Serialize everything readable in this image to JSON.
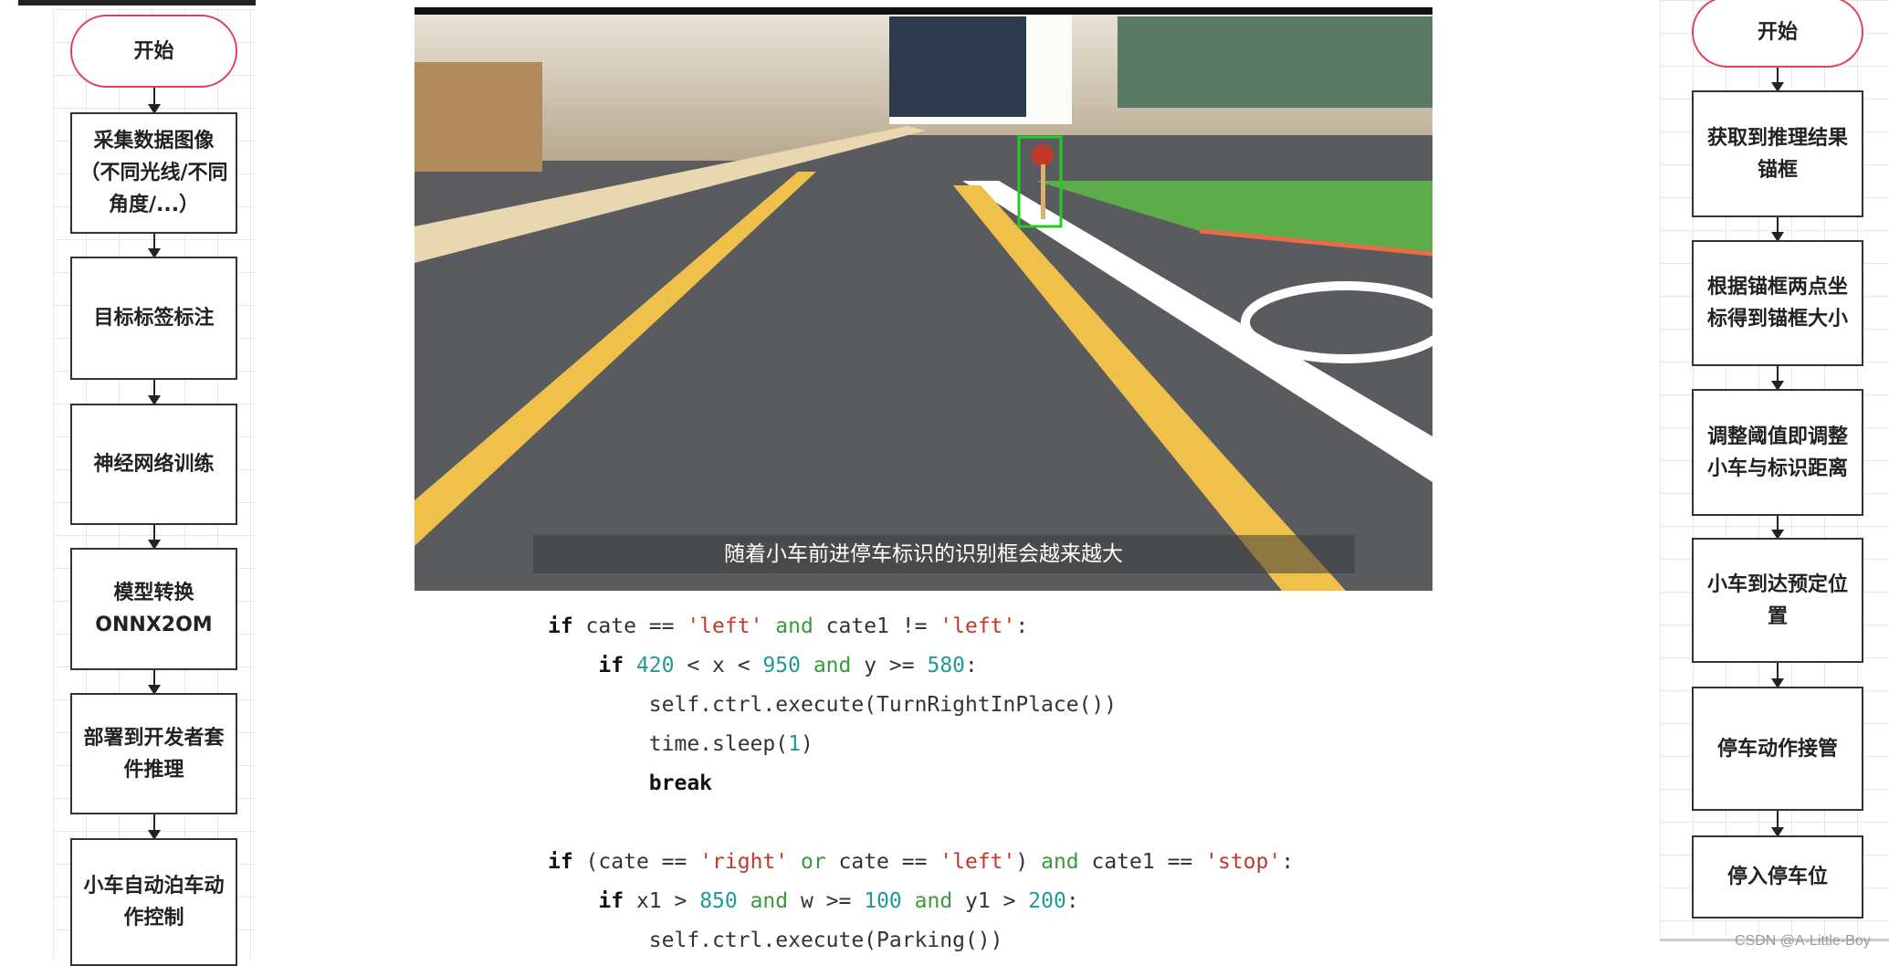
{
  "left_flow": {
    "start": "开始",
    "steps": [
      "采集数据图像（不同光线/不同角度/...）",
      "目标标签标注",
      "神经网络训练",
      "模型转换ONNX2OM",
      "部署到开发者套件推理",
      "小车自动泊车动作控制"
    ]
  },
  "video": {
    "subtitle": "随着小车前进停车标识的识别框会越来越大",
    "detection_box_color": "#22cc22"
  },
  "code": {
    "lines": [
      [
        {
          "t": "if",
          "c": "kw"
        },
        {
          "t": " cate == "
        },
        {
          "t": "'left'",
          "c": "st"
        },
        {
          "t": " and ",
          "c": "op"
        },
        {
          "t": "cate1 != "
        },
        {
          "t": "'left'",
          "c": "st"
        },
        {
          "t": ":"
        }
      ],
      [
        {
          "t": "    "
        },
        {
          "t": "if",
          "c": "kw"
        },
        {
          "t": " "
        },
        {
          "t": "420",
          "c": "nm"
        },
        {
          "t": " < x < "
        },
        {
          "t": "950",
          "c": "nm"
        },
        {
          "t": " and ",
          "c": "op"
        },
        {
          "t": "y >= "
        },
        {
          "t": "580",
          "c": "nm"
        },
        {
          "t": ":"
        }
      ],
      [
        {
          "t": "        self.ctrl.execute(TurnRightInPlace())"
        }
      ],
      [
        {
          "t": "        time.sleep("
        },
        {
          "t": "1",
          "c": "nm"
        },
        {
          "t": ")"
        }
      ],
      [
        {
          "t": "        "
        },
        {
          "t": "break",
          "c": "kw"
        }
      ],
      [
        {
          "t": ""
        }
      ],
      [
        {
          "t": "if",
          "c": "kw"
        },
        {
          "t": " (cate == "
        },
        {
          "t": "'right'",
          "c": "st"
        },
        {
          "t": " or ",
          "c": "op"
        },
        {
          "t": "cate == "
        },
        {
          "t": "'left'",
          "c": "st"
        },
        {
          "t": ") "
        },
        {
          "t": "and",
          "c": "op"
        },
        {
          "t": " cate1 == "
        },
        {
          "t": "'stop'",
          "c": "st"
        },
        {
          "t": ":"
        }
      ],
      [
        {
          "t": "    "
        },
        {
          "t": "if",
          "c": "kw"
        },
        {
          "t": " x1 > "
        },
        {
          "t": "850",
          "c": "nm"
        },
        {
          "t": " and ",
          "c": "op"
        },
        {
          "t": "w >= "
        },
        {
          "t": "100",
          "c": "nm"
        },
        {
          "t": " and ",
          "c": "op"
        },
        {
          "t": "y1 > "
        },
        {
          "t": "200",
          "c": "nm"
        },
        {
          "t": ":"
        }
      ],
      [
        {
          "t": "        self.ctrl.execute(Parking())"
        }
      ]
    ]
  },
  "right_flow": {
    "start": "开始",
    "steps": [
      "获取到推理结果锚框",
      "根据锚框两点坐标得到锚框大小",
      "调整阈值即调整小车与标识距离",
      "小车到达预定位置",
      "停车动作接管",
      "停入停车位"
    ]
  },
  "watermark": "CSDN @A-Little-Boy"
}
